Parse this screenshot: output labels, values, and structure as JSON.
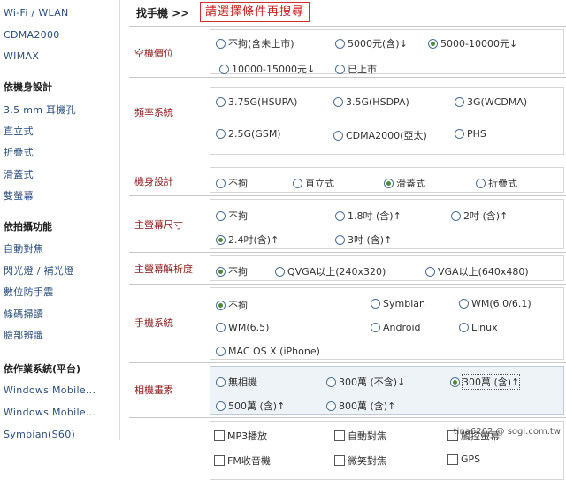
{
  "sidebar": {
    "top_items": [
      "Wi-Fi / WLAN",
      "CDMA2000",
      "WIMAX"
    ],
    "sections": [
      {
        "heading": "依機身設計",
        "items": [
          "3.5 mm 耳機孔",
          "直立式",
          "折疊式",
          "滑蓋式",
          "雙螢幕"
        ]
      },
      {
        "heading": "依拍攝功能",
        "items": [
          "自動對焦",
          "閃光燈 / 補光燈",
          "數位防手震",
          "條碼掃讀",
          "臉部辨識"
        ]
      },
      {
        "heading": "依作業系統(平台)",
        "items": [
          "Windows Mobile...",
          "Windows Mobile...",
          "Symbian(S60)"
        ]
      }
    ]
  },
  "header": {
    "title": "找手機 >>",
    "notice": "請選擇條件再搜尋"
  },
  "filters": {
    "price": {
      "label": "空機價位",
      "options": [
        "不拘(含未上市)",
        "5000元(含)↓",
        "5000-10000元↓",
        "10000-15000元↓",
        "已上市"
      ],
      "selected": "5000-10000元↓"
    },
    "band": {
      "label": "頻率系統",
      "options": [
        "3.75G(HSUPA)",
        "3.5G(HSDPA)",
        "3G(WCDMA)",
        "2.5G(GSM)",
        "CDMA2000(亞太)",
        "PHS"
      ],
      "selected": ""
    },
    "design": {
      "label": "機身設計",
      "options": [
        "不拘",
        "直立式",
        "滑蓋式",
        "折疊式"
      ],
      "selected": "滑蓋式"
    },
    "screen_size": {
      "label": "主螢幕尺寸",
      "options": [
        "不拘",
        "1.8吋 (含)↑",
        "2吋 (含)↑",
        "2.4吋(含)↑",
        "3吋 (含)↑"
      ],
      "selected": "2.4吋(含)↑"
    },
    "resolution": {
      "label": "主螢幕解析度",
      "options": [
        "不拘",
        "QVGA以上(240x320)",
        "VGA以上(640x480)"
      ],
      "selected": "不拘"
    },
    "os": {
      "label": "手機系統",
      "options": [
        "不拘",
        "Symbian",
        "WM(6.0/6.1)",
        "WM(6.5)",
        "Android",
        "Linux",
        "MAC OS X (iPhone)"
      ],
      "selected": "不拘"
    },
    "camera": {
      "label": "相機畫素",
      "options": [
        "無相機",
        "300萬 (不含)↓",
        "300萬 (含)↑",
        "500萬 (含)↑",
        "800萬 (含)↑"
      ],
      "selected": "300萬 (含)↑"
    },
    "features": {
      "label": "",
      "options": [
        "MP3播放",
        "自動對焦",
        "觸控螢幕",
        "FM收音機",
        "微笑對焦",
        "GPS"
      ],
      "checked": []
    }
  },
  "watermark": "tina6262 @ sogi.com.tw"
}
